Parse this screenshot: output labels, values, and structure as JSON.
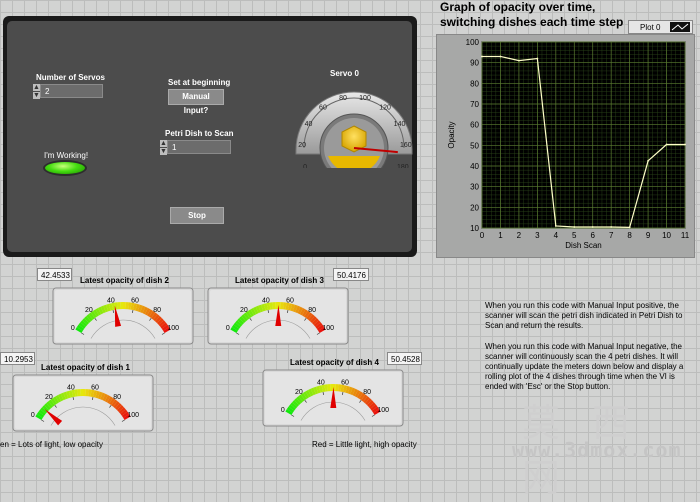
{
  "front_panel": {
    "num_servos_label": "Number of Servos",
    "num_servos_value": "2",
    "set_label": "Set at beginning",
    "manual_button_label": "Manual Input?",
    "petri_label": "Petri Dish to Scan",
    "petri_value": "1",
    "working_label": "I'm Working!",
    "stop_label": "Stop",
    "servo": {
      "label": "Servo 0",
      "ticks": [
        "0",
        "20",
        "40",
        "60",
        "80",
        "100",
        "120",
        "140",
        "160",
        "180"
      ],
      "value": 168
    }
  },
  "graph": {
    "title_line1": "Graph of opacity over time,",
    "title_line2": "switching dishes each time step",
    "legend_label": "Plot 0",
    "colors": {
      "plot_bg": "#000000",
      "grid": "#5a7a30",
      "line": "#ffffc8"
    },
    "chart_data": {
      "type": "line",
      "xlabel": "Dish Scan",
      "ylabel": "Opacity",
      "xlim": [
        0,
        11
      ],
      "ylim": [
        10,
        100
      ],
      "xticks": [
        "0",
        "1",
        "2",
        "3",
        "4",
        "5",
        "6",
        "7",
        "8",
        "9",
        "10",
        "11"
      ],
      "yticks": [
        "10",
        "20",
        "30",
        "40",
        "50",
        "60",
        "70",
        "80",
        "90",
        "100"
      ],
      "grid": true,
      "series": [
        {
          "values": [
            [
              0,
              93
            ],
            [
              1,
              93
            ],
            [
              2,
              91
            ],
            [
              3,
              92
            ],
            [
              4,
              11
            ],
            [
              5,
              10.5
            ],
            [
              6,
              10.5
            ],
            [
              7,
              10.5
            ],
            [
              8,
              10.3
            ],
            [
              9,
              42.5
            ],
            [
              10,
              50.4
            ],
            [
              11,
              50.4
            ]
          ]
        }
      ]
    }
  },
  "meters": {
    "ticks": [
      "0",
      "20",
      "40",
      "60",
      "80",
      "100"
    ],
    "dish2": {
      "title": "Latest opacity of dish 2",
      "readout": "42.4533",
      "value": 42.4533
    },
    "dish3": {
      "title": "Latest opacity of dish 3",
      "readout": "50.4176",
      "value": 50.4176
    },
    "dish1": {
      "title": "Latest opacity of dish 1",
      "readout": "10.2953",
      "value": 10.2953
    },
    "dish4": {
      "title": "Latest opacity of dish 4",
      "readout": "50.4528",
      "value": 50.4528
    }
  },
  "description": {
    "para1": "When you run this code with Manual Input positive, the scanner will scan the petri dish indicated in Petri Dish to Scan and return the results.",
    "para2": "When you run this code with Manual Input negative, the scanner will continuously scan the 4 petri dishes. It will continually update the meters down below and display a rolling plot of the 4 dishes through time when the VI is ended with 'Esc' or the Stop button."
  },
  "captions": {
    "left": "en = Lots of light, low opacity",
    "right": "Red = Little light, high opacity"
  },
  "watermark": {
    "line1": "莫 西 网",
    "line2": "www.3dmox.com"
  }
}
